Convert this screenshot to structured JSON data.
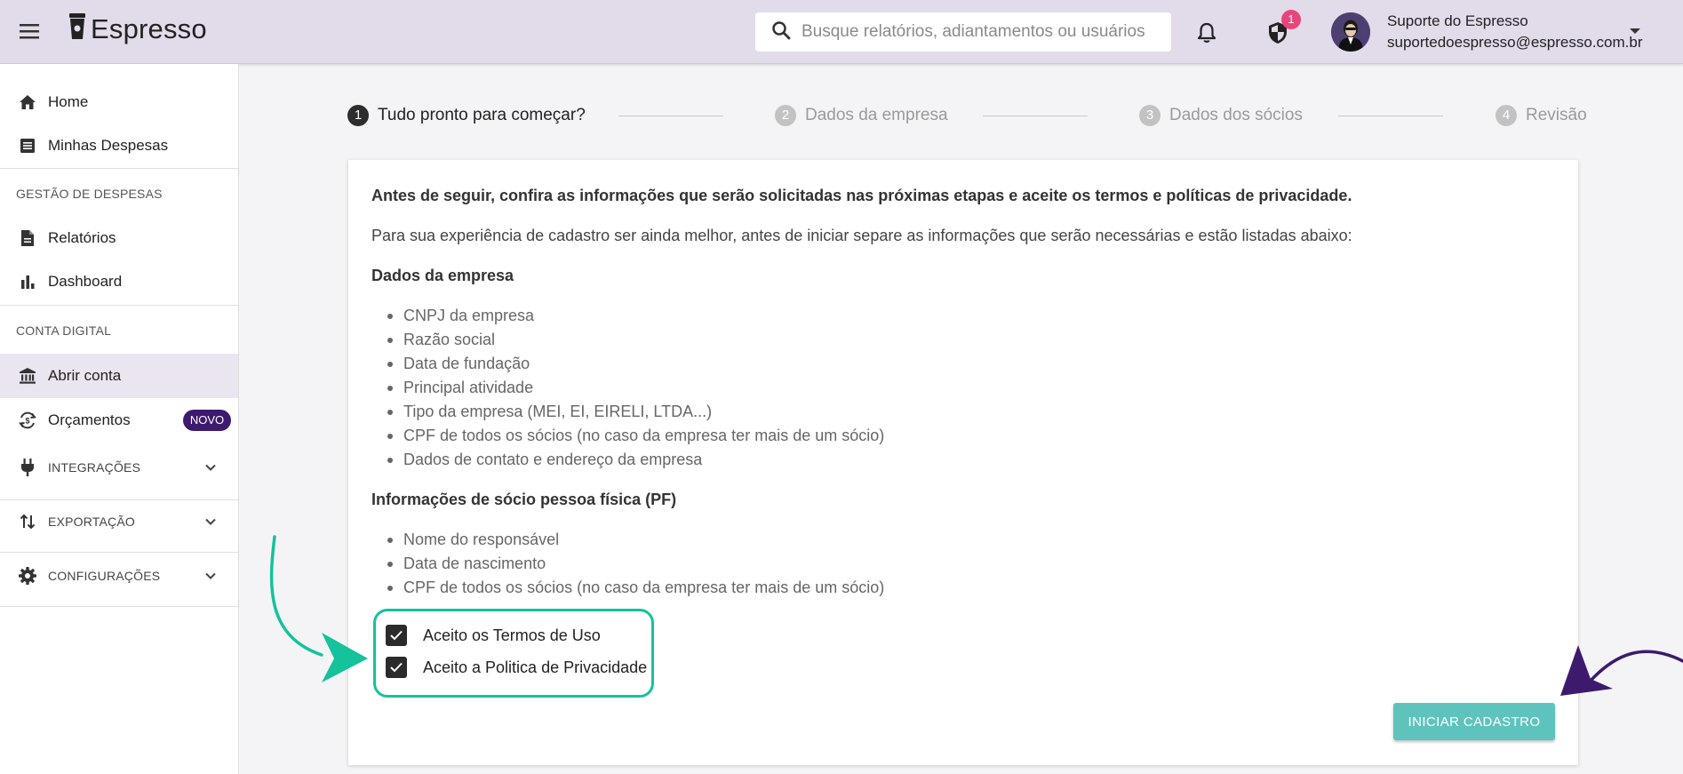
{
  "header": {
    "app_name": "Espresso",
    "search_placeholder": "Busque relatórios, adiantamentos ou usuários",
    "notification_badge": "1",
    "user_name": "Suporte do Espresso",
    "user_email": "suportedoespresso@espresso.com.br"
  },
  "sidebar": {
    "home": "Home",
    "my_expenses": "Minhas Despesas",
    "section_expenses": "GESTÃO DE DESPESAS",
    "reports": "Relatórios",
    "dashboard": "Dashboard",
    "section_digital": "CONTA DIGITAL",
    "open_account": "Abrir conta",
    "budgets": "Orçamentos",
    "budgets_badge": "NOVO",
    "integrations": "INTEGRAÇÕES",
    "export": "EXPORTAÇÃO",
    "settings": "CONFIGURAÇÕES"
  },
  "stepper": {
    "steps": [
      {
        "num": "1",
        "label": "Tudo pronto para começar?"
      },
      {
        "num": "2",
        "label": "Dados da empresa"
      },
      {
        "num": "3",
        "label": "Dados dos sócios"
      },
      {
        "num": "4",
        "label": "Revisão"
      }
    ],
    "active_step": 1
  },
  "card": {
    "intro_bold": "Antes de seguir, confira as informações que serão solicitadas nas próximas etapas e aceite os termos e políticas de privacidade.",
    "intro": "Para sua experiência de cadastro ser ainda melhor, antes de iniciar separe as informações que serão necessárias e estão listadas abaixo:",
    "company_heading": "Dados da empresa",
    "company_items": [
      "CNPJ da empresa",
      "Razão social",
      "Data de fundação",
      "Principal atividade",
      "Tipo da empresa (MEI, EI, EIRELI, LTDA...)",
      "CPF de todos os sócios (no caso da empresa ter mais de um sócio)",
      "Dados de contato e endereço da empresa"
    ],
    "partner_heading": "Informações de sócio pessoa física (PF)",
    "partner_items": [
      "Nome do responsável",
      "Data de nascimento",
      "CPF de todos os sócios (no caso da empresa ter mais de um sócio)"
    ],
    "terms_label": "Aceito os Termos de Uso",
    "terms_checked": true,
    "privacy_label": "Aceito a Politica de Privacidade",
    "privacy_checked": true,
    "start_button": "INICIAR CADASTRO"
  },
  "colors": {
    "header_bg": "#e2dbe9",
    "accent_teal": "#5ec3bd",
    "highlight_green": "#14c29b",
    "arrow_purple": "#3d1a6e",
    "badge_pink": "#e8457a"
  }
}
